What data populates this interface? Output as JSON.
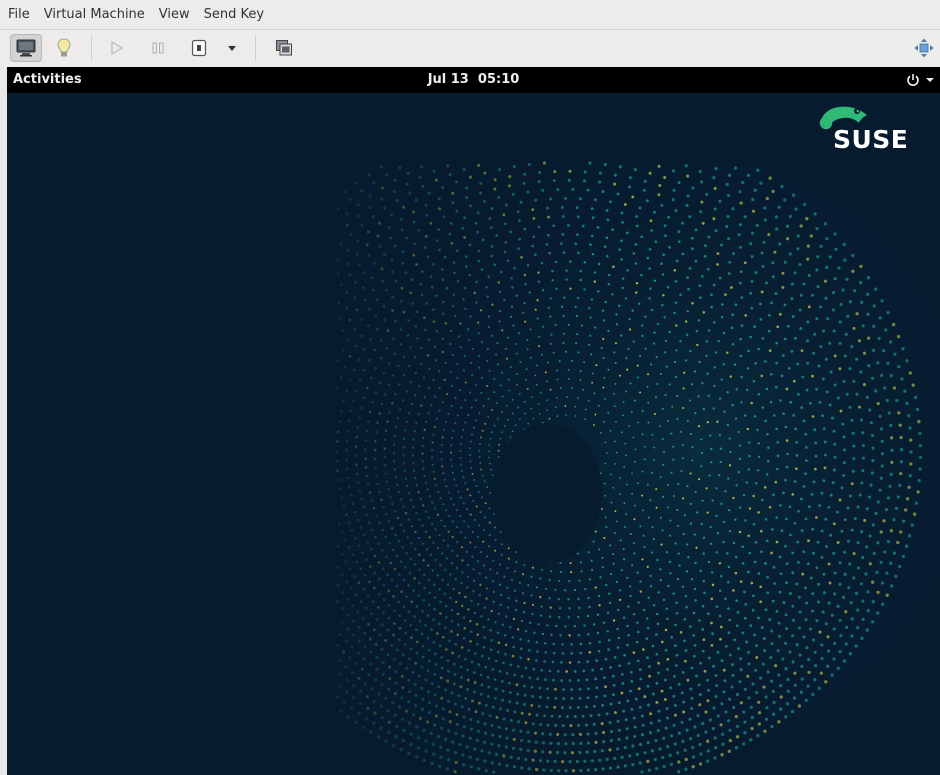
{
  "menubar": {
    "items": [
      "File",
      "Virtual Machine",
      "View",
      "Send Key"
    ]
  },
  "toolbar": {
    "buttons": [
      {
        "name": "console-view",
        "icon": "monitor-icon",
        "active": true
      },
      {
        "name": "details-view",
        "icon": "lightbulb-icon",
        "active": false
      },
      {
        "name": "run",
        "icon": "play-icon",
        "enabled": false
      },
      {
        "name": "pause",
        "icon": "pause-icon",
        "enabled": false
      },
      {
        "name": "shutdown",
        "icon": "power-icon",
        "enabled": true
      },
      {
        "name": "shutdown-menu",
        "icon": "chevron-down-icon",
        "enabled": true
      },
      {
        "name": "snapshots",
        "icon": "snapshot-icon",
        "enabled": true
      },
      {
        "name": "fullscreen",
        "icon": "resize-arrows-icon",
        "enabled": true
      }
    ]
  },
  "guest": {
    "topbar": {
      "activities_label": "Activities",
      "clock": "Jul 13  05:10"
    },
    "logo_text": "SUSE",
    "colors": {
      "background": "#071b2f",
      "accent_green": "#30ba78",
      "dot_teal": "#1fa99b",
      "dot_yellow": "#c8d94c"
    }
  }
}
